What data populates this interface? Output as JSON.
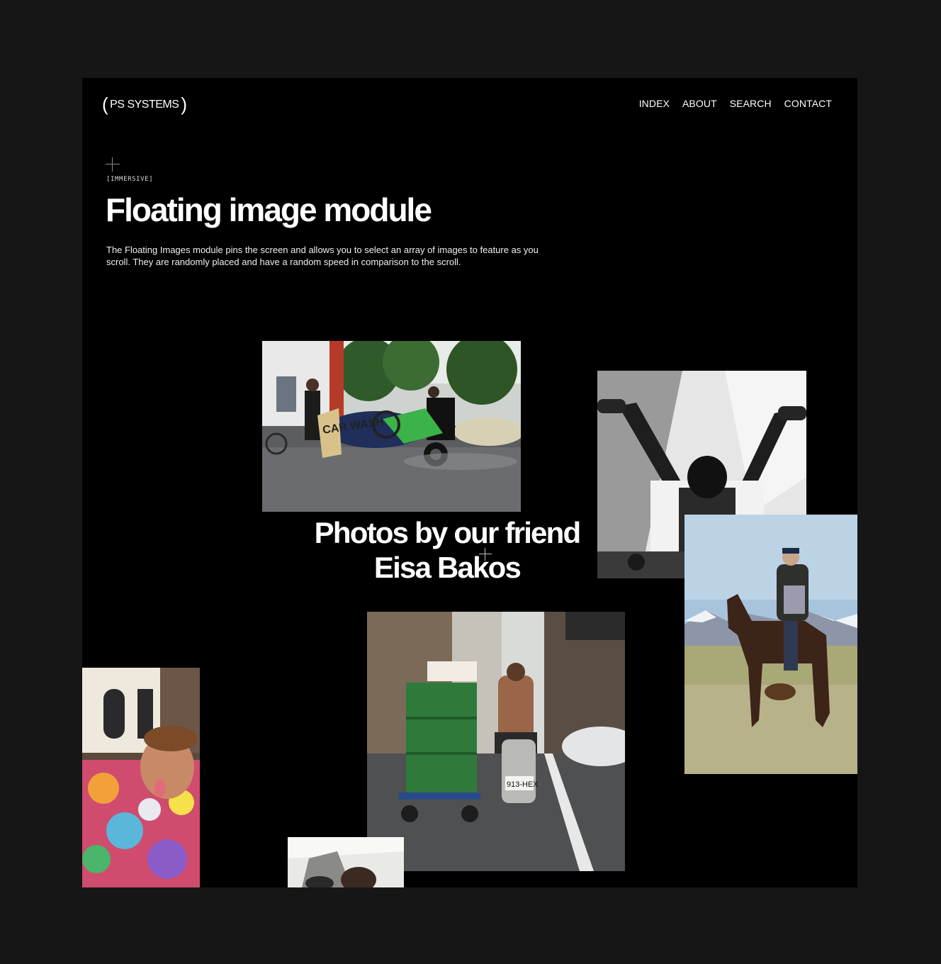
{
  "header": {
    "logo_text": "PS SYSTEMS",
    "nav": [
      "INDEX",
      "ABOUT",
      "SEARCH",
      "CONTACT"
    ]
  },
  "intro": {
    "tag": "[IMMERSIVE]",
    "title": "Floating image module",
    "description": "The Floating Images module pins the screen and allows you to select an array of images to feature as you scroll. They are randomly placed and have a random speed in comparison to the scroll."
  },
  "feature": {
    "line1": "Photos by our friend",
    "line2": "Eisa Bakos"
  },
  "photos": {
    "car_wash_sign": "CAR WASH",
    "plate": "913-HEX"
  },
  "colors": {
    "outer_bg": "#161616",
    "frame_bg": "#000000",
    "text": "#ffffff"
  }
}
